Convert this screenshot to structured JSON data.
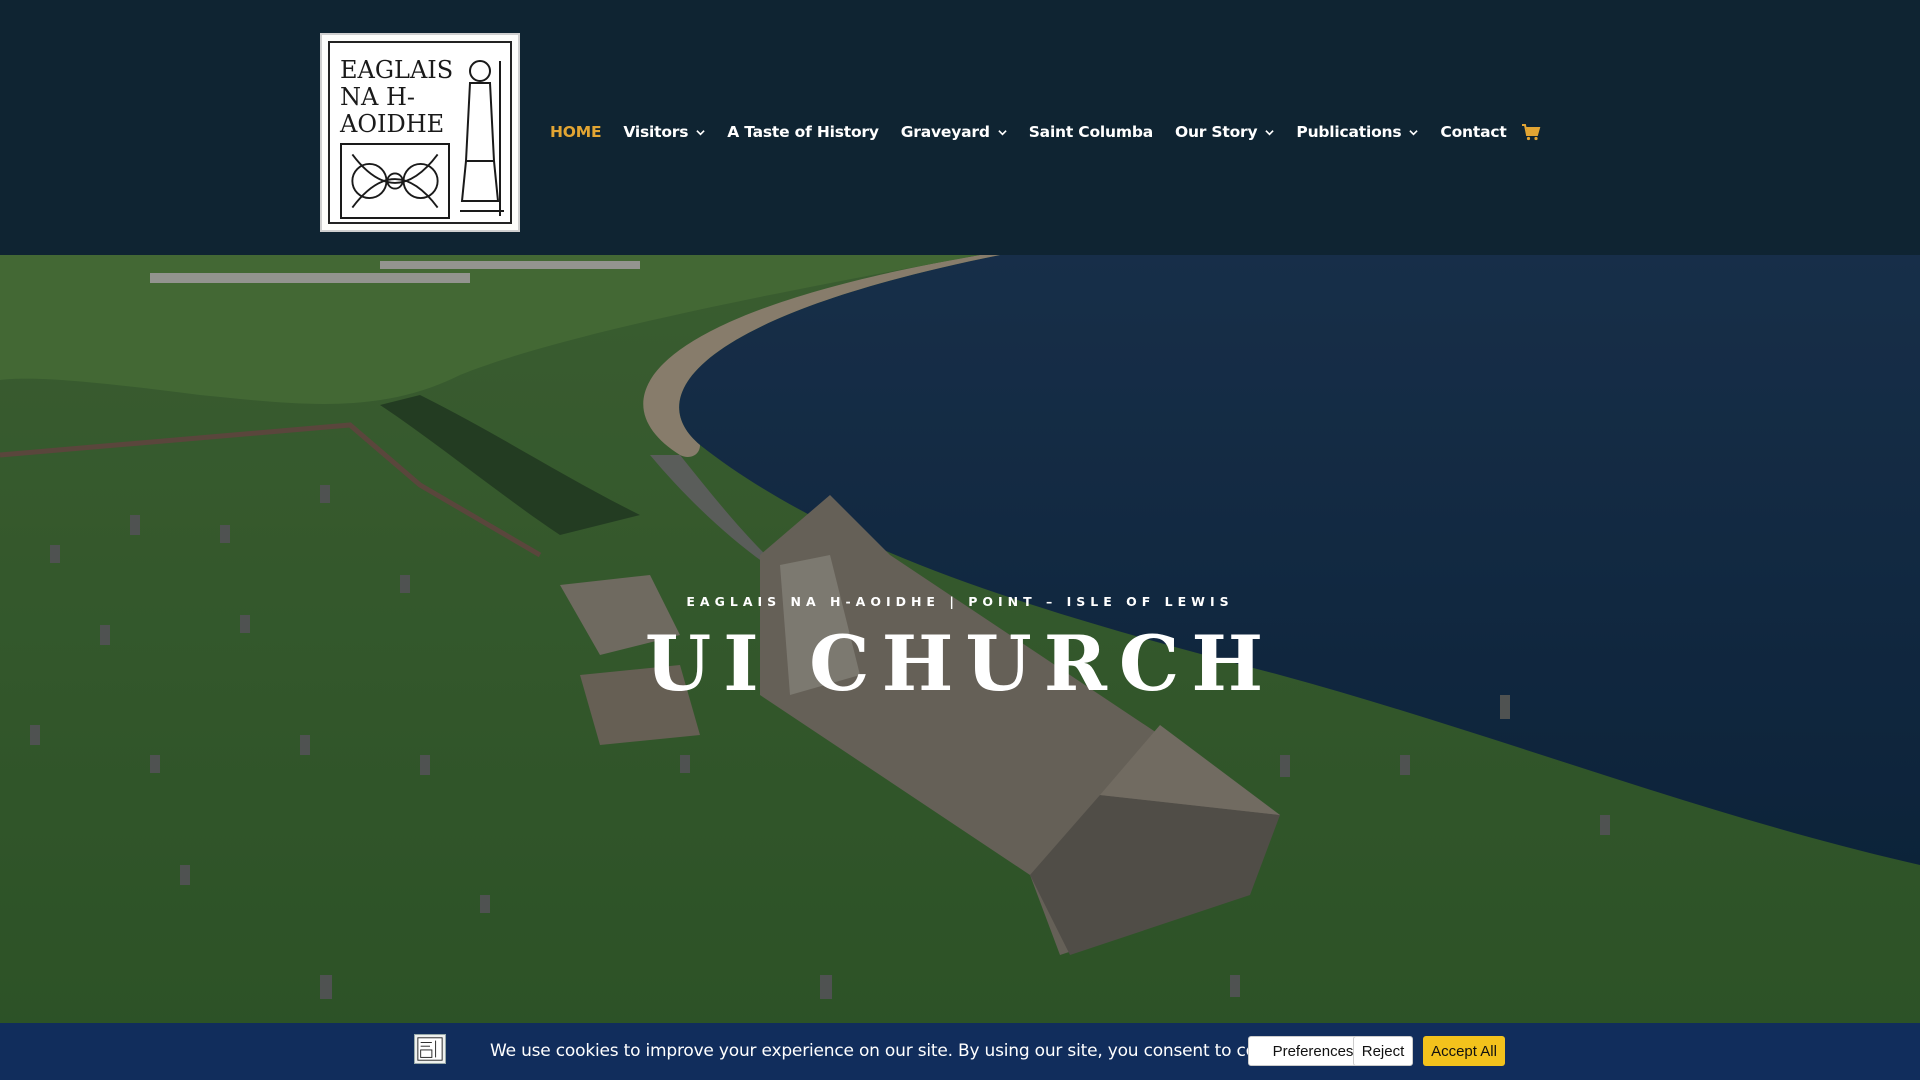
{
  "header": {
    "logo": {
      "alt": "Eaglais na h-Aoidhe logo",
      "lines": [
        "EAGLAIS",
        "NA H-",
        "AOIDHE"
      ]
    },
    "nav": [
      {
        "label": "HOME",
        "active": true,
        "dropdown": false
      },
      {
        "label": "Visitors",
        "active": false,
        "dropdown": true
      },
      {
        "label": "A Taste of History",
        "active": false,
        "dropdown": false
      },
      {
        "label": "Graveyard",
        "active": false,
        "dropdown": true
      },
      {
        "label": "Saint Columba",
        "active": false,
        "dropdown": false
      },
      {
        "label": "Our Story",
        "active": false,
        "dropdown": true
      },
      {
        "label": "Publications",
        "active": false,
        "dropdown": true
      },
      {
        "label": "Contact",
        "active": false,
        "dropdown": false
      }
    ],
    "cart_icon": "shopping-cart-icon"
  },
  "hero": {
    "subtitle": "EAGLAIS NA H-AOIDHE | POINT – ISLE OF LEWIS",
    "title": "UI CHURCH"
  },
  "cookie_bar": {
    "message": "We use cookies to improve your experience on our site. By using our site, you consent to cookies.",
    "preferences_label": "Preferences",
    "reject_label": "Reject",
    "accept_label": "Accept All"
  },
  "colors": {
    "header_bg": "#0f2432",
    "nav_active": "#e2a533",
    "cookie_bg": "#112d5c",
    "accept_bg": "#f3c21c"
  }
}
